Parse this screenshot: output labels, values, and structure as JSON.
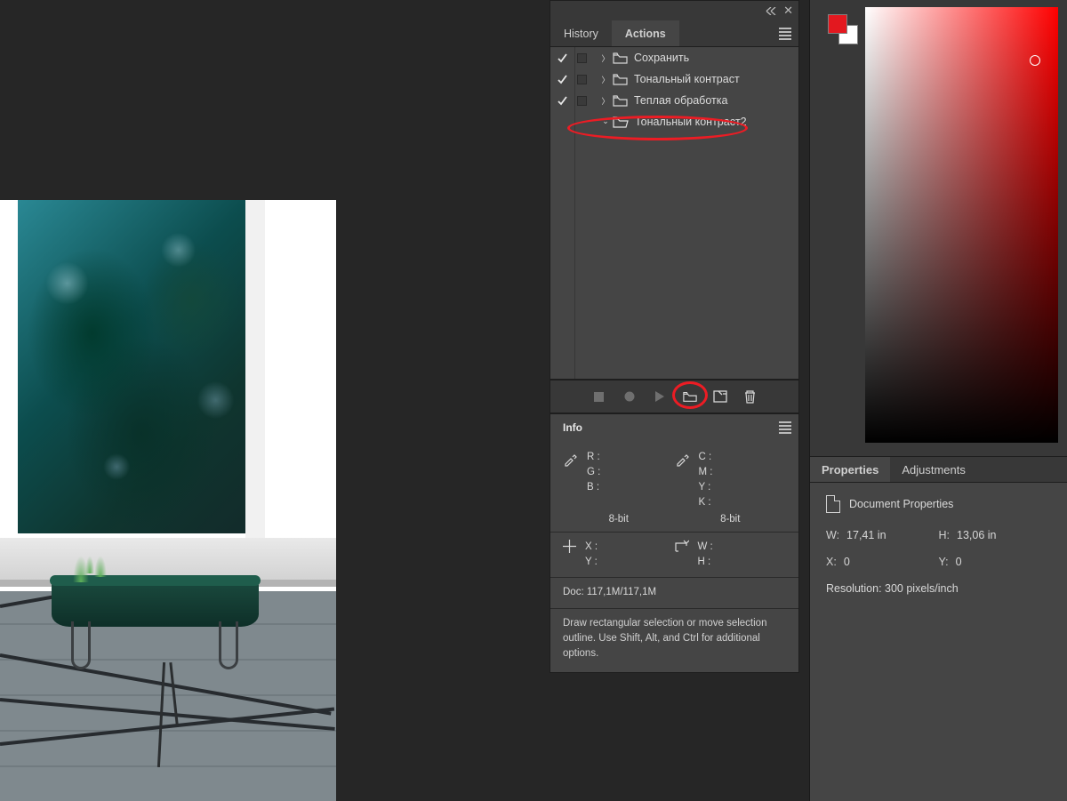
{
  "actionsPanel": {
    "tabs": {
      "history": "History",
      "actions": "Actions"
    },
    "items": [
      {
        "label": "Сохранить"
      },
      {
        "label": "Тональный контраст"
      },
      {
        "label": "Теплая обработка"
      },
      {
        "label": "Тональный контраст2"
      }
    ]
  },
  "infoPanel": {
    "title": "Info",
    "rgb": {
      "R": "R :",
      "G": "G :",
      "B": "B :",
      "bits": "8-bit"
    },
    "cmyk": {
      "C": "C :",
      "M": "M :",
      "Y": "Y :",
      "K": "K :",
      "bits": "8-bit"
    },
    "xy": {
      "X": "X :",
      "Y": "Y :"
    },
    "wh": {
      "W": "W :",
      "H": "H :"
    },
    "doc": "Doc:  117,1M/117,1M",
    "hint": "Draw rectangular selection or move selection outline.  Use Shift, Alt, and Ctrl for additional options."
  },
  "propsPanel": {
    "tabs": {
      "properties": "Properties",
      "adjustments": "Adjustments"
    },
    "title": "Document Properties",
    "W": {
      "label": "W:",
      "value": "17,41 in"
    },
    "H": {
      "label": "H:",
      "value": "13,06 in"
    },
    "X": {
      "label": "X:",
      "value": "0"
    },
    "Y": {
      "label": "Y:",
      "value": "0"
    },
    "resolution": "Resolution: 300 pixels/inch"
  },
  "colorPicker": {
    "foreground": "#e3181f",
    "background": "#ffffff"
  }
}
